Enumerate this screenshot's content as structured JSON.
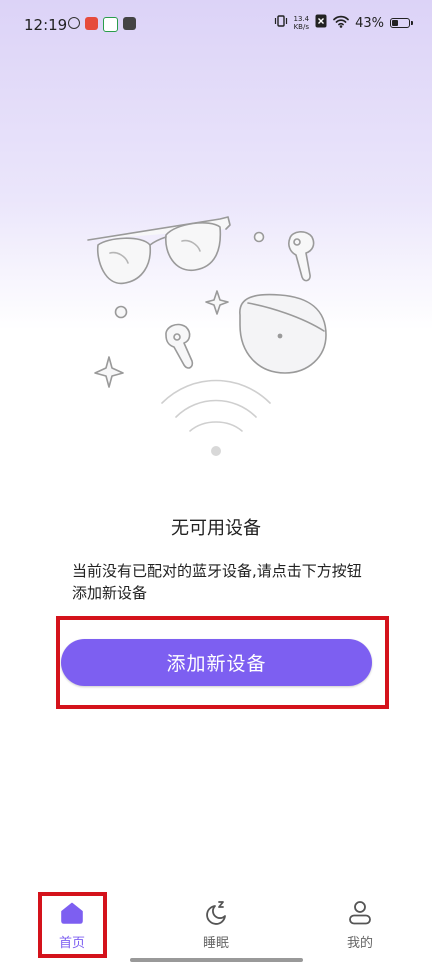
{
  "status_bar": {
    "time": "12:19",
    "net_speed_value": "13.4",
    "net_speed_unit": "KB/s",
    "battery_text": "43%",
    "battery_level": 0.43
  },
  "empty_state": {
    "title": "无可用设备",
    "description": "当前没有已配对的蓝牙设备,请点击下方按钮添加新设备"
  },
  "add_button_label": "添加新设备",
  "nav": {
    "items": [
      {
        "label": "首页",
        "icon": "home-icon",
        "active": true
      },
      {
        "label": "睡眠",
        "icon": "sleep-moon-icon",
        "active": false
      },
      {
        "label": "我的",
        "icon": "profile-icon",
        "active": false
      }
    ]
  },
  "colors": {
    "accent": "#7d5ff1",
    "highlight": "#d4121b"
  }
}
